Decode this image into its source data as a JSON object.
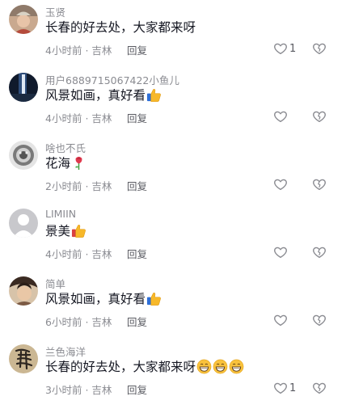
{
  "comments": [
    {
      "username": "玉贤",
      "text": "长春的好去处，大家都来呀",
      "emojis": [],
      "time": "4小时前",
      "location": "吉林",
      "reply": "回复",
      "likes": "1"
    },
    {
      "username": "用户6889715067422小鱼儿",
      "text": "风景如画，真好看",
      "emojis": [
        "thumbs-up"
      ],
      "time": "4小时前",
      "location": "吉林",
      "reply": "回复",
      "likes": ""
    },
    {
      "username": "啥也不氏",
      "text": "花海",
      "emojis": [
        "rose"
      ],
      "time": "2小时前",
      "location": "吉林",
      "reply": "回复",
      "likes": ""
    },
    {
      "username": "LIMIIN",
      "text": "景美",
      "emojis": [
        "thumbs-up"
      ],
      "time": "4小时前",
      "location": "吉林",
      "reply": "回复",
      "likes": ""
    },
    {
      "username": "简单",
      "text": "风景如画，真好看",
      "emojis": [
        "thumbs-up"
      ],
      "time": "6小时前",
      "location": "吉林",
      "reply": "回复",
      "likes": ""
    },
    {
      "username": "兰色海洋",
      "text": "长春的好去处，大家都来呀",
      "emojis": [
        "grinning-face",
        "grinning-face",
        "grinning-face"
      ],
      "time": "3小时前",
      "location": "吉林",
      "reply": "回复",
      "likes": "1"
    }
  ],
  "separator": "·",
  "colors": {
    "text": "#161823",
    "secondary": "#8a8b91",
    "icon": "#8a8b91"
  }
}
